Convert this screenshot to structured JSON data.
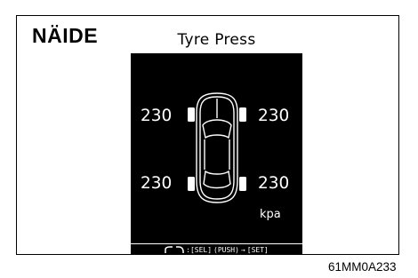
{
  "example_label": "NÄIDE",
  "figure_code": "61MM0A233",
  "display": {
    "title": "Tyre Press",
    "tires": {
      "front_left": "230",
      "front_right": "230",
      "rear_left": "230",
      "rear_right": "230"
    },
    "unit": "kpa",
    "footer": {
      "sel": ":[SEL]",
      "push": "(PUSH)",
      "set": "[SET]"
    }
  }
}
